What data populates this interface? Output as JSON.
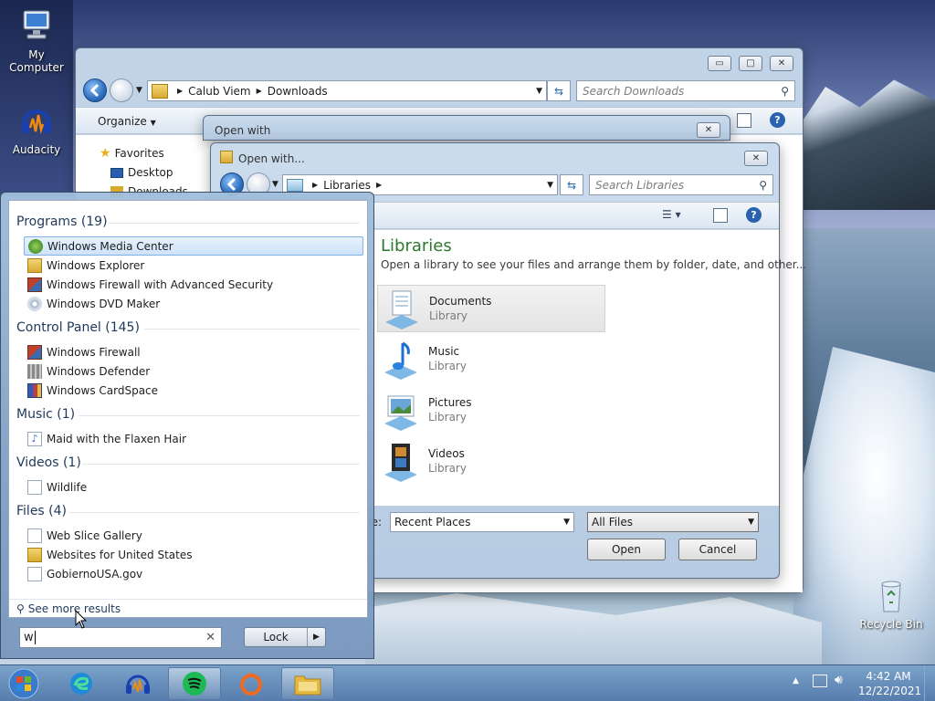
{
  "desktop": {
    "icons": [
      {
        "label": "My Computer"
      },
      {
        "label": "Audacity"
      },
      {
        "label": "Recycle Bin"
      }
    ]
  },
  "explorer": {
    "breadcrumb": [
      "Calub Viem",
      "Downloads"
    ],
    "search_placeholder": "Search Downloads",
    "organize_label": "Organize",
    "nav": {
      "favorites": "Favorites",
      "desktop": "Desktop",
      "downloads": "Downloads"
    }
  },
  "open_with_outer": {
    "title": "Open with"
  },
  "open_with_inner": {
    "title": "Open with...",
    "breadcrumb": [
      "Libraries"
    ],
    "search_placeholder": "Search Libraries",
    "heading": "Libraries",
    "subheading": "Open a library to see your files and arrange them by folder, date, and other...",
    "libraries": [
      {
        "name": "Documents",
        "type": "Library"
      },
      {
        "name": "Music",
        "type": "Library"
      },
      {
        "name": "Pictures",
        "type": "Library"
      },
      {
        "name": "Videos",
        "type": "Library"
      }
    ],
    "file_name_label": "ne:",
    "file_name_value": "Recent Places",
    "filter_value": "All Files",
    "open_label": "Open",
    "cancel_label": "Cancel"
  },
  "start_menu": {
    "categories": [
      {
        "title": "Programs (19)",
        "items": [
          "Windows Media Center",
          "Windows Explorer",
          "Windows Firewall with Advanced Security",
          "Windows DVD Maker"
        ]
      },
      {
        "title": "Control Panel (145)",
        "items": [
          "Windows Firewall",
          "Windows Defender",
          "Windows CardSpace"
        ]
      },
      {
        "title": "Music (1)",
        "items": [
          "Maid with the Flaxen Hair"
        ]
      },
      {
        "title": "Videos (1)",
        "items": [
          "Wildlife"
        ]
      },
      {
        "title": "Files (4)",
        "items": [
          "Web Slice Gallery",
          "Websites for United States",
          "GobiernoUSA.gov"
        ]
      }
    ],
    "see_more": "See more results",
    "search_value": "w",
    "lock_label": "Lock"
  },
  "taskbar": {
    "time": "4:42 AM",
    "date": "12/22/2021"
  },
  "colors": {
    "accent": "#1e395b",
    "library_heading": "#2a7a2a"
  }
}
